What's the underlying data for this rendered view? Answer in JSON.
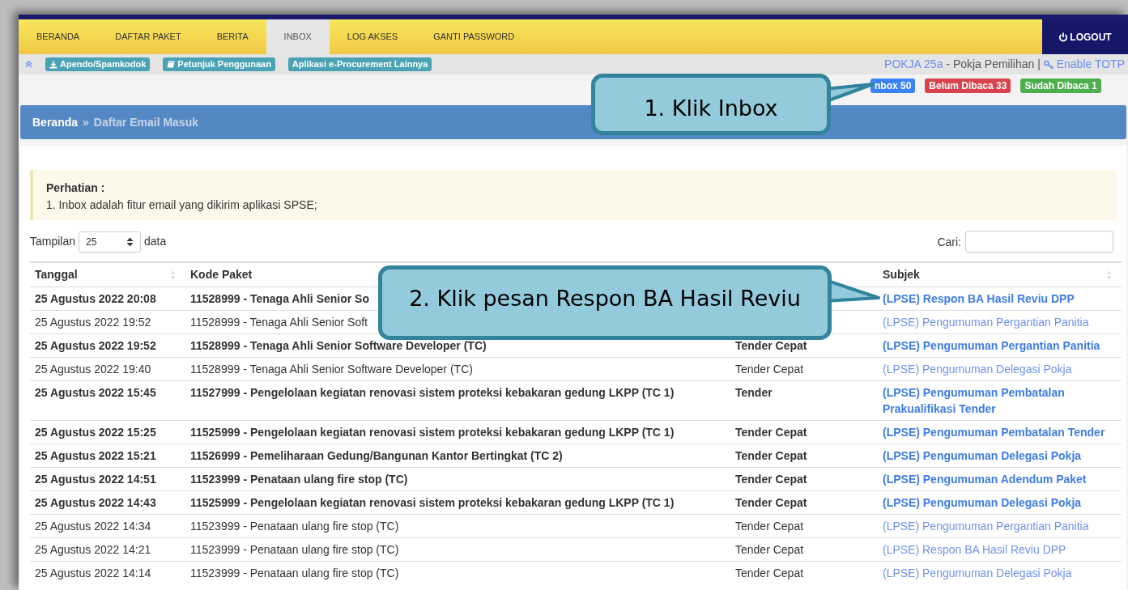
{
  "nav": {
    "tabs": [
      {
        "label": "BERANDA",
        "selected": false
      },
      {
        "label": "DAFTAR PAKET",
        "selected": false
      },
      {
        "label": "BERITA",
        "selected": false
      },
      {
        "label": "INBOX",
        "selected": true
      },
      {
        "label": "LOG AKSES",
        "selected": false
      },
      {
        "label": "GANTI PASSWORD",
        "selected": false
      }
    ],
    "logout": "LOGOUT"
  },
  "toolbar": {
    "buttons": [
      {
        "label": "Apendo/Spamkodok",
        "kind": "download"
      },
      {
        "label": "Petunjuk Penggunaan",
        "kind": "book"
      },
      {
        "label": "Aplikasi e-Procurement Lainnya",
        "kind": "plain"
      }
    ],
    "user": "POKJA 25a",
    "role": " - Pokja Pemilihan | ",
    "totp": "Enable TOTP"
  },
  "badges": [
    {
      "label": "nbox 50",
      "color": "#3b82f6"
    },
    {
      "label": "Belum Dibaca 33",
      "color": "#d9434e"
    },
    {
      "label": "Sudah Dibaca 1",
      "color": "#4cae4c"
    }
  ],
  "breadcrumb": {
    "home": "Beranda",
    "separator": "»",
    "current": "Daftar Email Masuk"
  },
  "notice": {
    "title": "Perhatian :",
    "text": "1. Inbox adalah fitur email yang dikirim aplikasi SPSE;"
  },
  "table_controls": {
    "show_label": "Tampilan",
    "page_size": "25",
    "data_label": "data",
    "search_label": "Cari:"
  },
  "table": {
    "headers": {
      "tanggal": "Tanggal",
      "kode_paket": "Kode Paket",
      "subjek": "Subjek"
    },
    "rows": [
      {
        "tanggal": "25 Agustus 2022 20:08",
        "kode_paket": "11528999 - Tenaga Ahli Senior So",
        "subjek": "(LPSE) Respon BA Hasil Reviu DPP",
        "unread": true
      },
      {
        "tanggal": "25 Agustus 2022 19:52",
        "kode_paket": "11528999 - Tenaga Ahli Senior Soft",
        "subjek": "(LPSE) Pengumuman Pergantian Panitia",
        "unread": false
      },
      {
        "tanggal": "25 Agustus 2022 19:52",
        "kode_paket": "11528999 - Tenaga Ahli Senior Software Developer (TC)",
        "column_3": "Tender Cepat",
        "subjek": "(LPSE) Pengumuman Pergantian Panitia",
        "unread": true
      },
      {
        "tanggal": "25 Agustus 2022 19:40",
        "kode_paket": "11528999 - Tenaga Ahli Senior Software Developer (TC)",
        "column_3": "Tender Cepat",
        "subjek": "(LPSE) Pengumuman Delegasi Pokja",
        "unread": false
      },
      {
        "tanggal": "25 Agustus 2022 15:45",
        "kode_paket": "11527999 - Pengelolaan kegiatan renovasi sistem proteksi kebakaran gedung LKPP (TC 1)",
        "column_3": "Tender",
        "subjek": "(LPSE) Pengumuman Pembatalan Prakualifikasi Tender",
        "unread": true
      },
      {
        "tanggal": "25 Agustus 2022 15:25",
        "kode_paket": "11525999 - Pengelolaan kegiatan renovasi sistem proteksi kebakaran gedung LKPP (TC 1)",
        "column_3": "Tender Cepat",
        "subjek": "(LPSE) Pengumuman Pembatalan Tender",
        "unread": true
      },
      {
        "tanggal": "25 Agustus 2022 15:21",
        "kode_paket": "11526999 - Pemeliharaan Gedung/Bangunan Kantor Bertingkat (TC 2)",
        "column_3": "Tender Cepat",
        "subjek": "(LPSE) Pengumuman Delegasi Pokja",
        "unread": true
      },
      {
        "tanggal": "25 Agustus 2022 14:51",
        "kode_paket": "11523999 - Penataan ulang fire stop (TC)",
        "column_3": "Tender Cepat",
        "subjek": "(LPSE) Pengumuman Adendum Paket",
        "unread": true
      },
      {
        "tanggal": "25 Agustus 2022 14:43",
        "kode_paket": "11525999 - Pengelolaan kegiatan renovasi sistem proteksi kebakaran gedung LKPP (TC 1)",
        "column_3": "Tender Cepat",
        "subjek": "(LPSE) Pengumuman Delegasi Pokja",
        "unread": true
      },
      {
        "tanggal": "25 Agustus 2022 14:34",
        "kode_paket": "11523999 - Penataan ulang fire stop (TC)",
        "column_3": "Tender Cepat",
        "subjek": "(LPSE) Pengumuman Pergantian Panitia",
        "unread": false
      },
      {
        "tanggal": "25 Agustus 2022 14:21",
        "kode_paket": "11523999 - Penataan ulang fire stop (TC)",
        "column_3": "Tender Cepat",
        "subjek": "(LPSE) Respon BA Hasil Reviu DPP",
        "unread": false
      },
      {
        "tanggal": "25 Agustus 2022 14:14",
        "kode_paket": "11523999 - Penataan ulang fire stop (TC)",
        "column_3": "Tender Cepat",
        "subjek": "(LPSE) Pengumuman Delegasi Pokja",
        "unread": false
      }
    ]
  },
  "callouts": [
    {
      "text": "1. Klik Inbox"
    },
    {
      "text": "2. Klik pesan Respon BA Hasil Reviu"
    }
  ]
}
